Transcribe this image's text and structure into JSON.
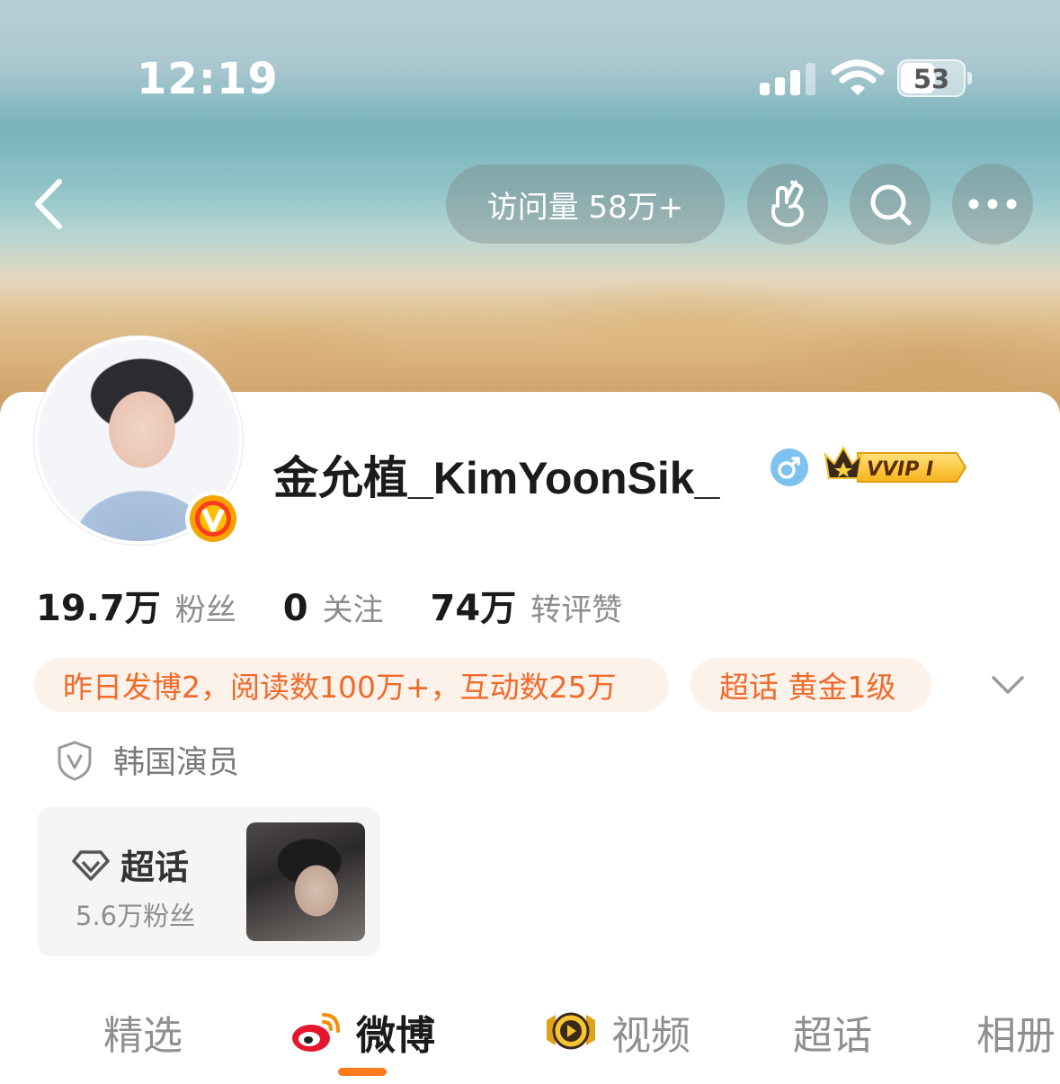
{
  "status_bar": {
    "time": "12:19",
    "battery_level": "53"
  },
  "header": {
    "visits_label": "访问量 58万+",
    "icons": [
      "back-arrow-icon",
      "finger-heart-icon",
      "search-icon",
      "more-icon"
    ]
  },
  "profile": {
    "name": "金允植_KimYoonSik_",
    "gender_icon": "male-icon",
    "vip_badge": "VVIP I",
    "stats": [
      {
        "value": "19.7万",
        "label": "粉丝"
      },
      {
        "value": "0",
        "label": "关注"
      },
      {
        "value": "74万",
        "label": "转评赞"
      }
    ],
    "tags": [
      "昨日发博2，阅读数100万+，互动数25万",
      "超话 黄金1级"
    ],
    "role": "韩国演员"
  },
  "super_topic": {
    "title": "超话",
    "fans": "5.6万粉丝"
  },
  "tabs": [
    {
      "label": "精选",
      "active": false
    },
    {
      "label": "微博",
      "active": true
    },
    {
      "label": "视频",
      "active": false
    },
    {
      "label": "超话",
      "active": false
    },
    {
      "label": "相册",
      "active": false
    }
  ],
  "colors": {
    "accent": "#f06a2a",
    "tag_bg": "#fdf2ea",
    "tab_underline": "#ff7a1a",
    "verified_gold": "#f5a400"
  }
}
